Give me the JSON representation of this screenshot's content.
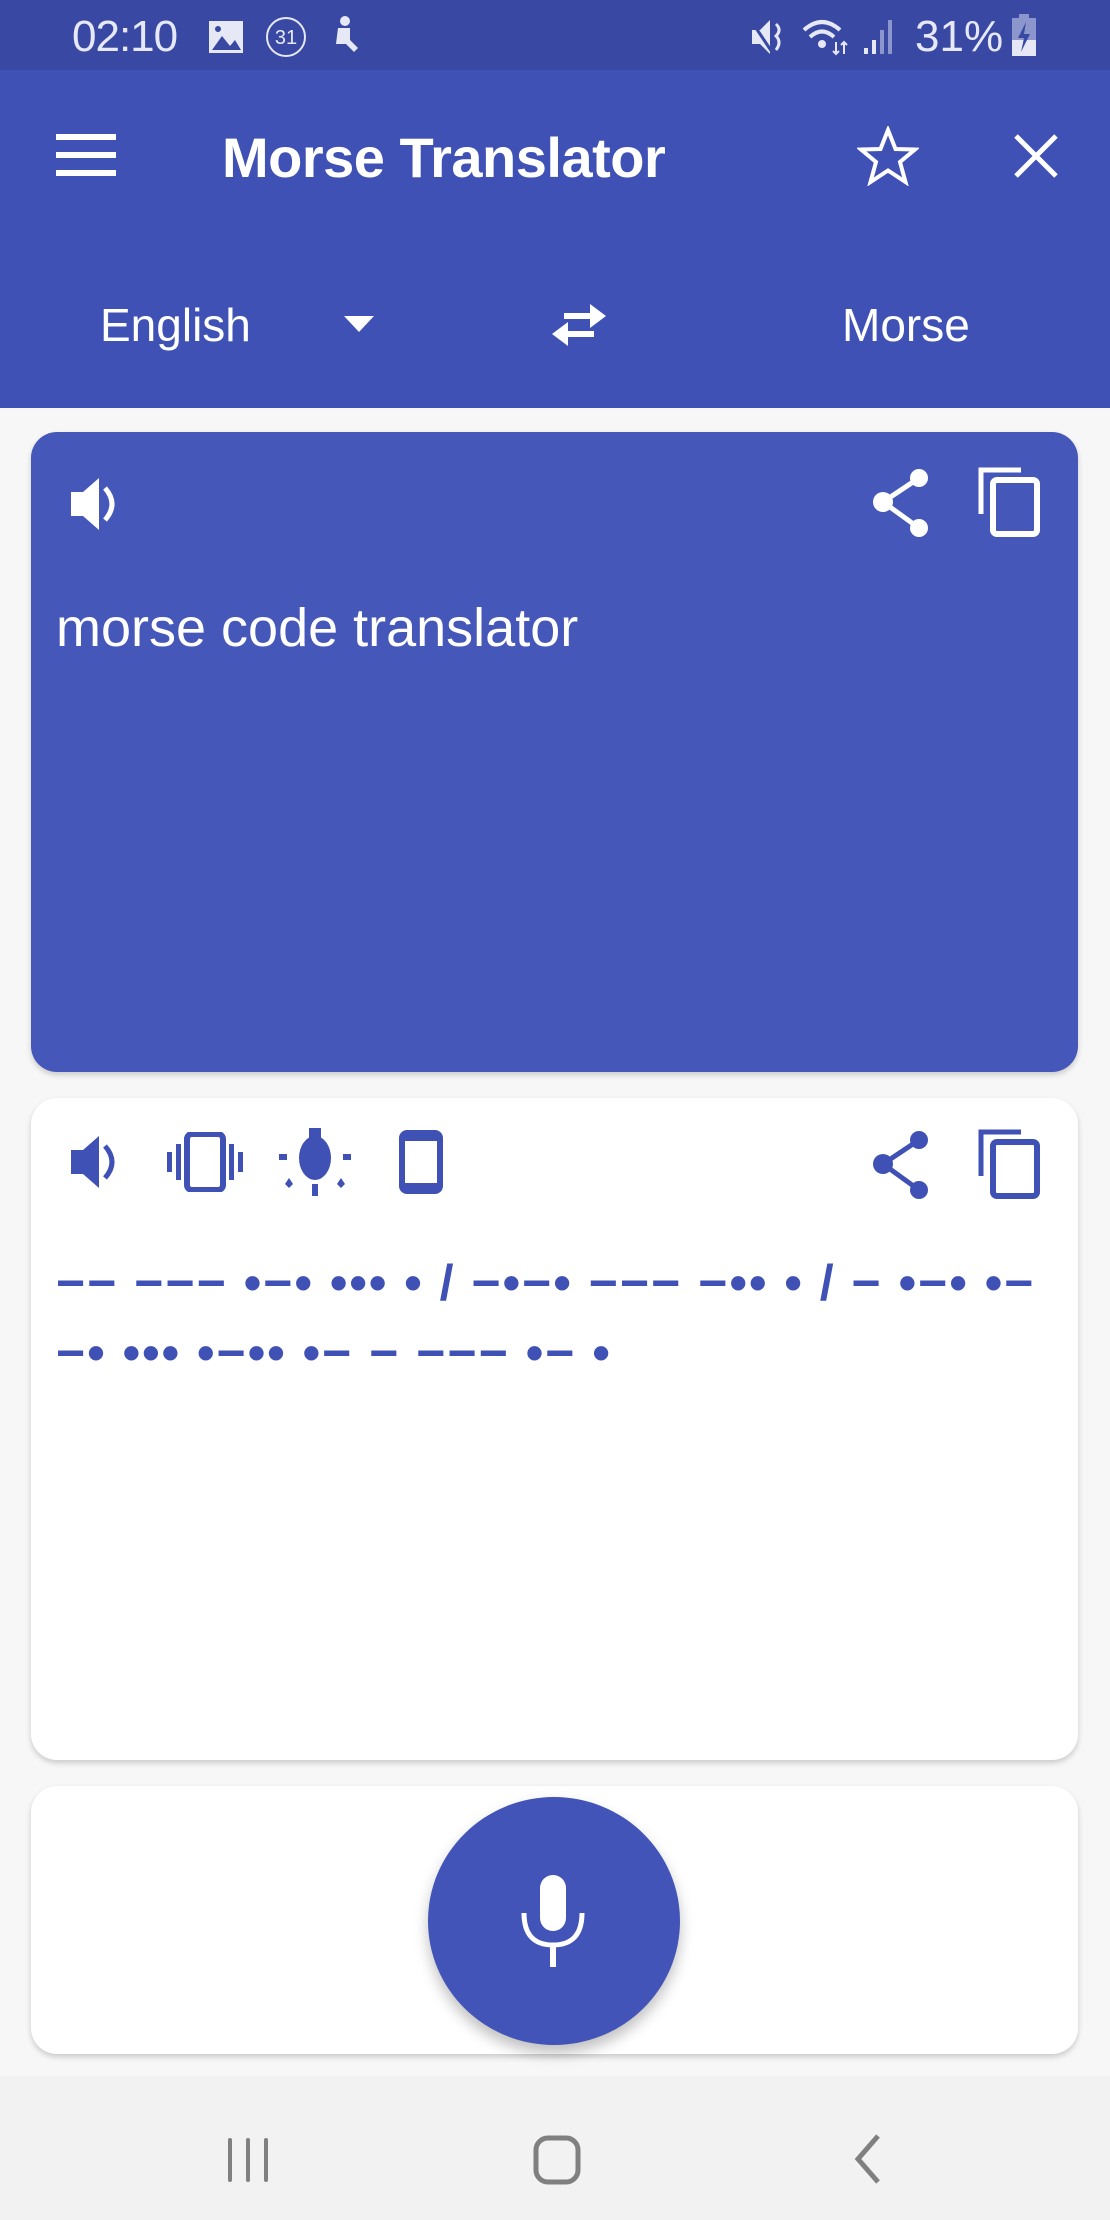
{
  "status_bar": {
    "time": "02:10",
    "left_icons": [
      "gallery-icon",
      "calendar-31-icon",
      "accessibility-icon"
    ],
    "right_icons": [
      "mute-icon",
      "wifi-icon",
      "signal-icon"
    ],
    "battery": "31%"
  },
  "app_bar": {
    "title": "Morse Translator",
    "menu_icon": "hamburger-menu-icon",
    "favorite_icon": "star-outline-icon",
    "close_icon": "close-icon"
  },
  "language_bar": {
    "source_language": "English",
    "target_language": "Morse",
    "swap_icon": "swap-arrows-icon"
  },
  "input_card": {
    "text": "morse code translator",
    "icons": [
      "speaker-icon",
      "share-icon",
      "copy-icon"
    ]
  },
  "output_card": {
    "morse": "−− −−− •−• ••• • / −•−• −−− −•• • / − •−• •− −• •••  •−•• •− − −−− •− •",
    "icons": [
      "speaker-icon",
      "vibrate-icon",
      "flashlight-icon",
      "screen-flash-icon",
      "share-icon",
      "copy-icon"
    ]
  },
  "mic": {
    "icon": "microphone-icon"
  },
  "nav_bar": {
    "icons": [
      "recent-apps-icon",
      "home-icon",
      "back-icon"
    ]
  },
  "colors": {
    "primary": "#3f51b5",
    "status_bar": "#3949a3",
    "input_card": "#4557b9",
    "background": "#f7f7f7"
  }
}
